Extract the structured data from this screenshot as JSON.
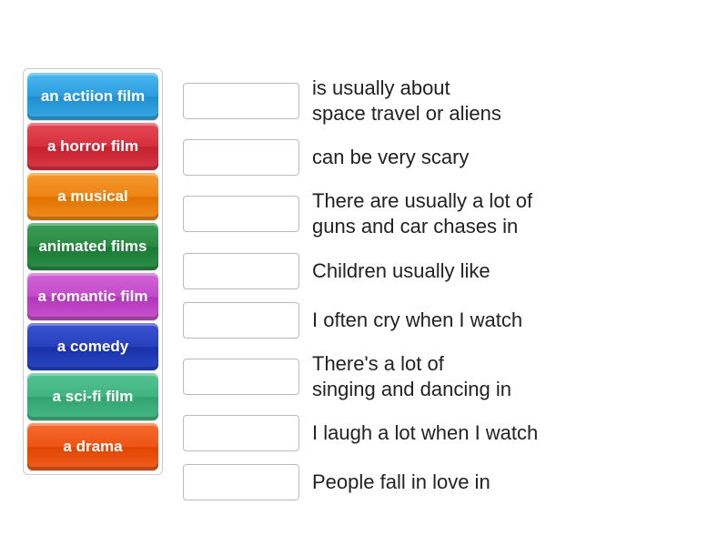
{
  "tiles": [
    {
      "label": "an actiion film",
      "colorClass": "tile-blue-light"
    },
    {
      "label": "a horror film",
      "colorClass": "tile-red"
    },
    {
      "label": "a musical",
      "colorClass": "tile-orange"
    },
    {
      "label": "animated films",
      "colorClass": "tile-green-dark"
    },
    {
      "label": "a romantic film",
      "colorClass": "tile-magenta"
    },
    {
      "label": "a comedy",
      "colorClass": "tile-blue-dark"
    },
    {
      "label": "a sci-fi film",
      "colorClass": "tile-teal"
    },
    {
      "label": "a drama",
      "colorClass": "tile-orange-red"
    }
  ],
  "rows": [
    {
      "text": "is usually about\nspace travel or aliens"
    },
    {
      "text": "can be very scary"
    },
    {
      "text": "There are usually a lot of\nguns and car chases in"
    },
    {
      "text": "Children usually like"
    },
    {
      "text": "I often cry when I watch"
    },
    {
      "text": "There's a lot of\nsinging and dancing in"
    },
    {
      "text": "I laugh a lot when I watch"
    },
    {
      "text": "People fall in love in"
    }
  ]
}
